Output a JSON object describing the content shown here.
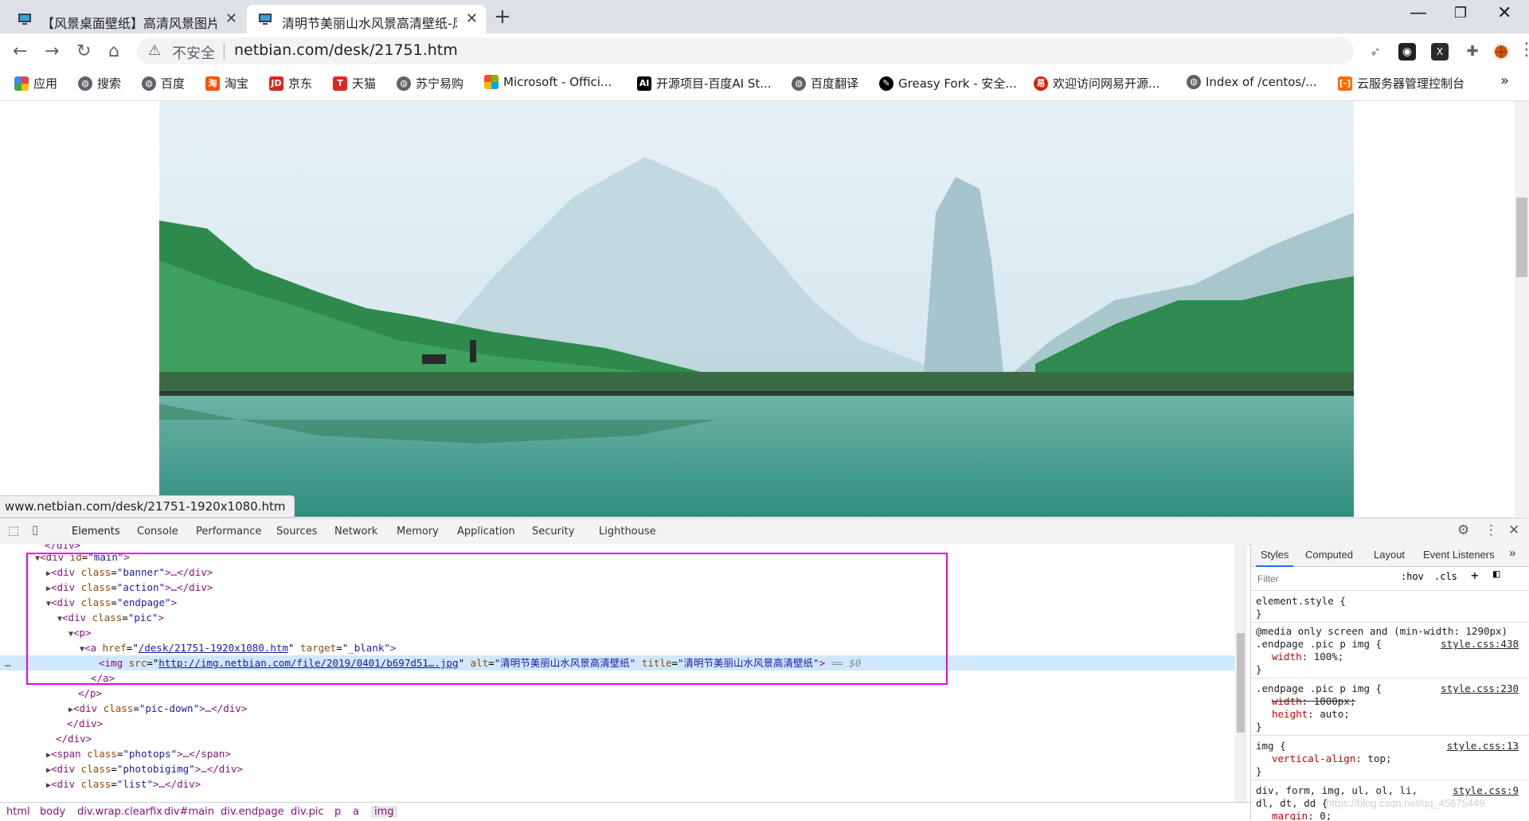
{
  "browser": {
    "tabs": [
      {
        "title": "【风景桌面壁纸】高清风景图片-",
        "active": false
      },
      {
        "title": "清明节美丽山水风景高清壁纸-风",
        "active": true
      }
    ],
    "new_tab": "+",
    "window_controls": {
      "minimize": "—",
      "restore": "❐",
      "close": "✕"
    },
    "address": {
      "insecure_label": "不安全",
      "separator": "|",
      "url": "netbian.com/desk/21751.htm"
    },
    "bookmarks": [
      {
        "label": "应用",
        "icon": "apps-grid-icon",
        "color": "#4285f4"
      },
      {
        "label": "搜索",
        "icon": "globe-icon",
        "color": "#5f6368"
      },
      {
        "label": "百度",
        "icon": "globe-icon",
        "color": "#5f6368"
      },
      {
        "label": "淘宝",
        "icon": "taobao-icon",
        "color": "#ff5000"
      },
      {
        "label": "京东",
        "icon": "jd-icon",
        "color": "#e1251b"
      },
      {
        "label": "天猫",
        "icon": "tmall-icon",
        "color": "#e1251b"
      },
      {
        "label": "苏宁易购",
        "icon": "globe-icon",
        "color": "#5f6368"
      },
      {
        "label": "Microsoft - Offici...",
        "icon": "microsoft-icon",
        "color": "#f25022"
      },
      {
        "label": "开源项目-百度AI St...",
        "icon": "ai-icon",
        "color": "#000000"
      },
      {
        "label": "百度翻译",
        "icon": "globe-icon",
        "color": "#5f6368"
      },
      {
        "label": "Greasy Fork - 安全...",
        "icon": "greasyfork-icon",
        "color": "#000000"
      },
      {
        "label": "欢迎访问网易开源...",
        "icon": "netease-icon",
        "color": "#d81e06"
      },
      {
        "label": "Index of /centos/...",
        "icon": "globe-icon",
        "color": "#5f6368"
      },
      {
        "label": "云服务器管理控制台",
        "icon": "aliyun-icon",
        "color": "#ff6a00"
      }
    ],
    "bookmarks_overflow": "»",
    "status_url": "www.netbian.com/desk/21751-1920x1080.htm"
  },
  "devtools": {
    "tabs": [
      "Elements",
      "Console",
      "Performance",
      "Sources",
      "Network",
      "Memory",
      "Application",
      "Security",
      "Lighthouse"
    ],
    "selected_tab": "Elements",
    "styles_tabs": [
      "Styles",
      "Computed",
      "Layout",
      "Event Listeners"
    ],
    "filter_placeholder": "Filter",
    "hov": ":hov",
    "cls": ".cls",
    "dom": {
      "top_cut": "</div>",
      "main_open": {
        "tag": "<div",
        "attr": "id",
        "val": "\"main\"",
        "close": ">"
      },
      "banner": {
        "tag": "<div",
        "attr": "class",
        "val": "\"banner\"",
        "rest": ">…</div>"
      },
      "action": {
        "tag": "<div",
        "attr": "class",
        "val": "\"action\"",
        "rest": ">…</div>"
      },
      "endpage": {
        "tag": "<div",
        "attr": "class",
        "val": "\"endpage\"",
        "rest": ">"
      },
      "pic": {
        "tag": "<div",
        "attr": "class",
        "val": "\"pic\"",
        "rest": ">"
      },
      "p_open": "<p>",
      "a_open": {
        "tag": "<a",
        "attr1": "href",
        "val1": "/desk/21751-1920x1080.htm",
        "attr2": "target",
        "val2": "\"_blank\"",
        "rest": ">"
      },
      "img": {
        "tag": "<img",
        "attr1": "src",
        "val1": "http://img.netbian.com/file/2019/0401/b697d51….jpg",
        "attr2": "alt",
        "val2": "\"清明节美丽山水风景高清壁纸\"",
        "attr3": "title",
        "val3": "\"清明节美丽山水风景高清壁纸\"",
        "rest": ">",
        "eq": "== $0"
      },
      "a_close": "</a>",
      "p_close": "</p>",
      "picdown": {
        "tag": "<div",
        "attr": "class",
        "val": "\"pic-down\"",
        "rest": ">…</div>"
      },
      "div_close1": "</div>",
      "div_close2": "</div>",
      "photops": {
        "tag": "<span",
        "attr": "class",
        "val": "\"photops\"",
        "rest": ">…</span>"
      },
      "photobigimg": {
        "tag": "<div",
        "attr": "class",
        "val": "\"photobigimg\"",
        "rest": ">…</div>"
      },
      "list": {
        "tag": "<div",
        "attr": "class",
        "val": "\"list\"",
        "rest": ">…</div>"
      }
    },
    "breadcrumbs": [
      "html",
      "body",
      "div.wrap.clearfix",
      "div#main",
      "div.endpage",
      "div.pic",
      "p",
      "a",
      "img"
    ],
    "styles": {
      "element_style": "element.style {",
      "close_brace": "}",
      "media": "@media only screen and (min-width: 1290px)",
      "rule1": {
        "selector": ".endpage .pic p img {",
        "source": "style.css:438",
        "prop": "width",
        "value": "100%;"
      },
      "rule2": {
        "selector": ".endpage .pic p img {",
        "source": "style.css:230",
        "prop1": "width",
        "value1": "1000px;",
        "prop2": "height",
        "value2": "auto;"
      },
      "rule3": {
        "selector": "img {",
        "source": "style.css:13",
        "prop": "vertical-align",
        "value": "top;"
      },
      "rule4": {
        "selector": "div, form, img, ul, ol, li,",
        "selector2": "dl, dt, dd {",
        "source": "style.css:9",
        "prop": "margin",
        "value": "0;"
      }
    },
    "watermark": "https://blog.csdn.net/qq_45675449"
  }
}
